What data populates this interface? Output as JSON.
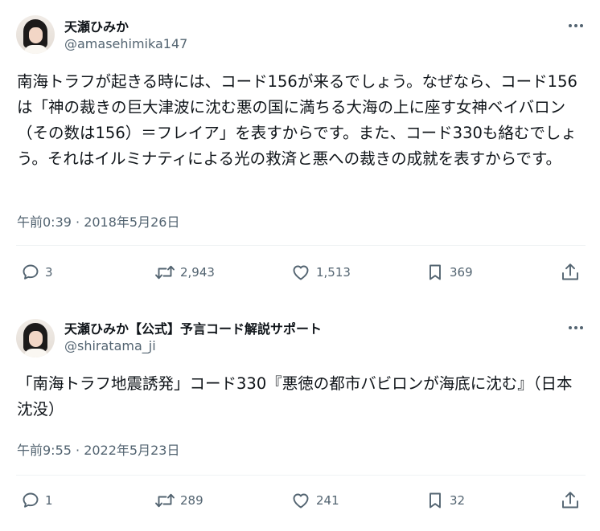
{
  "tweets": [
    {
      "author": {
        "name": "天瀬ひみか",
        "handle": "@amasehimika147"
      },
      "text": "南海トラフが起きる時には、コード156が来るでしょう。なぜなら、コード156は「神の裁きの巨大津波に沈む悪の国に満ちる大海の上に座す女神ベイバロン（その数は156）＝フレイア」を表すからです。また、コード330も絡むでしょう。それはイルミナティによる光の救済と悪への裁きの成就を表すからです。",
      "timestamp": "午前0:39 · 2018年5月26日",
      "stats": {
        "replies": "3",
        "retweets": "2,943",
        "likes": "1,513",
        "bookmarks": "369"
      }
    },
    {
      "author": {
        "name": "天瀬ひみか【公式】予言コード解説サポート",
        "handle": "@shiratama_ji"
      },
      "text": "「南海トラフ地震誘発」コード330『悪徳の都市バビロンが海底に沈む』（日本沈没）",
      "timestamp": "午前9:55 · 2022年5月23日",
      "stats": {
        "replies": "1",
        "retweets": "289",
        "likes": "241",
        "bookmarks": "32"
      }
    }
  ],
  "colors": {
    "text": "#0f1419",
    "secondary": "#536471",
    "divider": "#eff3f4",
    "background": "#ffffff"
  },
  "icons": [
    "avatar",
    "more-dots-icon",
    "reply-icon",
    "retweet-icon",
    "like-icon",
    "bookmark-icon",
    "share-icon"
  ]
}
